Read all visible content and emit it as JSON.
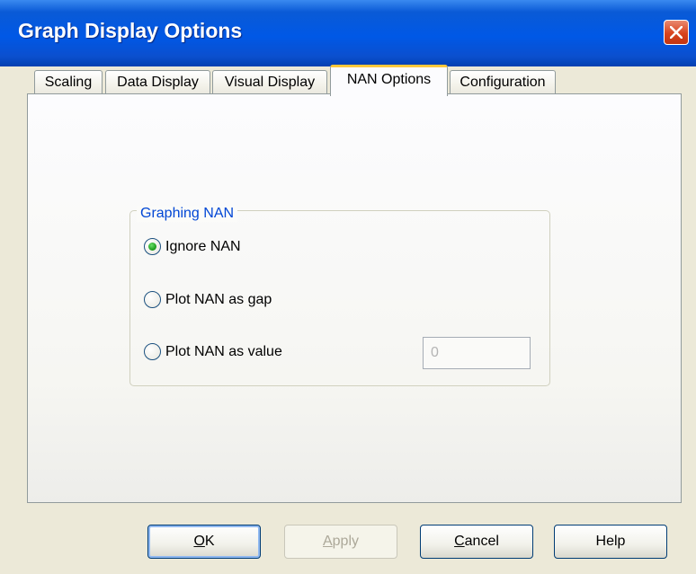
{
  "window": {
    "title": "Graph Display Options"
  },
  "tabs": [
    {
      "label": "Scaling",
      "active": false
    },
    {
      "label": "Data Display",
      "active": false
    },
    {
      "label": "Visual Display",
      "active": false
    },
    {
      "label": "NAN Options",
      "active": true
    },
    {
      "label": "Configuration",
      "active": false
    }
  ],
  "group": {
    "title": "Graphing NAN",
    "options": [
      {
        "label": "Ignore NAN",
        "checked": true
      },
      {
        "label": "Plot NAN as gap",
        "checked": false
      },
      {
        "label": "Plot NAN as value",
        "checked": false
      }
    ],
    "value_field": {
      "value": "0",
      "enabled": false
    }
  },
  "buttons": {
    "ok": {
      "mnemonic": "O",
      "rest": "K",
      "enabled": true,
      "default": true
    },
    "apply": {
      "mnemonic": "A",
      "rest": "pply",
      "enabled": false
    },
    "cancel": {
      "mnemonic": "C",
      "rest": "ancel",
      "enabled": true
    },
    "help": {
      "label": "Help",
      "enabled": true
    }
  },
  "colors": {
    "titlebar": "#0058e6",
    "close_button": "#d8431d",
    "group_title": "#0046d5",
    "active_tab_accent": "#ffc83c",
    "radio_selected": "#21a121"
  },
  "icons": {
    "close": "close-x-icon"
  }
}
